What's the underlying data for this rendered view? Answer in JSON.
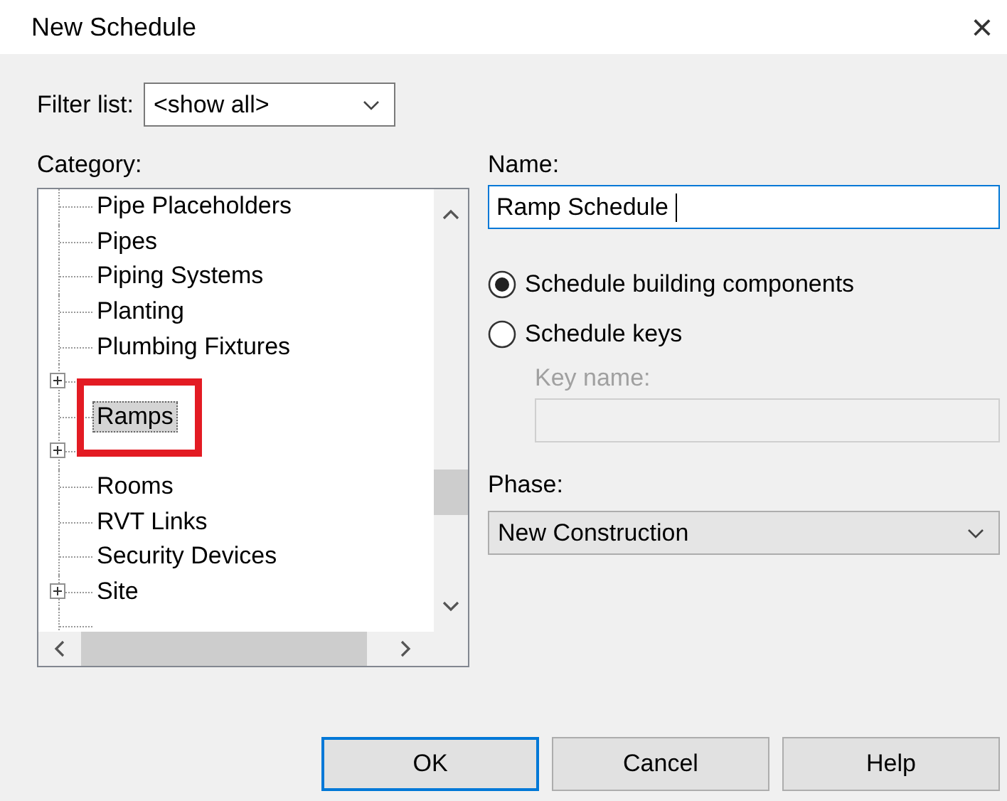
{
  "window": {
    "title": "New Schedule",
    "close": "×"
  },
  "filter": {
    "label": "Filter list:",
    "value": "<show all>"
  },
  "category": {
    "label": "Category:",
    "items": [
      {
        "label": "Pipe Placeholders",
        "kind": "leaf",
        "selected": false,
        "highlighted": false
      },
      {
        "label": "Pipes",
        "kind": "leaf",
        "selected": false,
        "highlighted": false
      },
      {
        "label": "Piping Systems",
        "kind": "leaf",
        "selected": false,
        "highlighted": false
      },
      {
        "label": "Planting",
        "kind": "leaf",
        "selected": false,
        "highlighted": false
      },
      {
        "label": "Plumbing Fixtures",
        "kind": "leaf",
        "selected": false,
        "highlighted": false
      },
      {
        "kind": "node",
        "selected": false,
        "highlighted": false
      },
      {
        "label": "Ramps",
        "kind": "leaf",
        "selected": true,
        "highlighted": true
      },
      {
        "kind": "node",
        "selected": false,
        "highlighted": false
      },
      {
        "label": "Rooms",
        "kind": "leaf",
        "selected": false,
        "highlighted": false
      },
      {
        "label": "RVT Links",
        "kind": "leaf",
        "selected": false,
        "highlighted": false
      },
      {
        "label": "Security Devices",
        "kind": "leaf",
        "selected": false,
        "highlighted": false
      },
      {
        "label": "Site",
        "kind": "node",
        "selected": false,
        "highlighted": false
      },
      {
        "kind": "leaf",
        "selected": false,
        "highlighted": false
      }
    ]
  },
  "name": {
    "label": "Name:",
    "value": "Ramp Schedule "
  },
  "schedule_type": [
    {
      "label": "Schedule building components",
      "selected": true
    },
    {
      "label": "Schedule keys",
      "selected": false
    }
  ],
  "key_name": {
    "label": "Key name:",
    "disabled": true
  },
  "phase": {
    "label": "Phase:",
    "value": "New Construction"
  },
  "buttons": [
    {
      "label": "OK",
      "default": true
    },
    {
      "label": "Cancel",
      "default": false
    },
    {
      "label": "Help",
      "default": false
    }
  ]
}
